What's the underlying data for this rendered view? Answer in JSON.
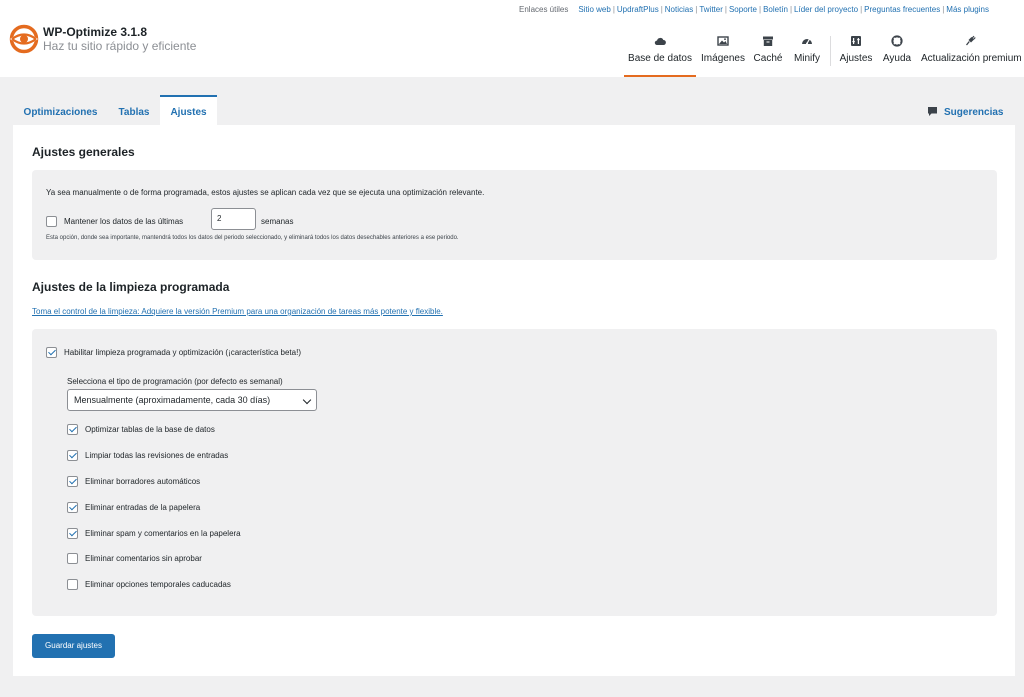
{
  "header": {
    "title": "WP-Optimize 3.1.8",
    "subtitle": "Haz tu sitio rápido y eficiente",
    "useful_links_label": "Enlaces útiles",
    "links": [
      "Sitio web",
      "UpdraftPlus",
      "Noticias",
      "Twitter",
      "Soporte",
      "Boletín",
      "Líder del proyecto",
      "Preguntas frecuentes",
      "Más plugins"
    ]
  },
  "nav": [
    {
      "label": "Base de datos",
      "icon": "cloud-icon"
    },
    {
      "label": "Imágenes",
      "icon": "images-icon"
    },
    {
      "label": "Caché",
      "icon": "archive-icon"
    },
    {
      "label": "Minify",
      "icon": "dashboard-icon"
    },
    {
      "label": "Ajustes",
      "icon": "settings-icon"
    },
    {
      "label": "Ayuda",
      "icon": "lifebuoy-icon"
    },
    {
      "label": "Actualización premium",
      "icon": "plug-icon"
    }
  ],
  "tabs": [
    "Optimizaciones",
    "Tablas",
    "Ajustes"
  ],
  "active_tab": "Ajustes",
  "feedback_label": "Sugerencias",
  "general": {
    "heading": "Ajustes generales",
    "description": "Ya sea manualmente o de forma programada, estos ajustes se aplican cada vez que se ejecuta una optimización relevante.",
    "keep_prefix": "Mantener los datos de las últimas",
    "keep_value": "2",
    "keep_suffix": "semanas",
    "keep_checked": false,
    "note": "Esta opción, donde sea importante, mantendrá todos los datos del periodo seleccionado, y eliminará todos los datos desechables anteriores a ese periodo."
  },
  "scheduled": {
    "heading": "Ajustes de la limpieza programada",
    "premium_link": "Toma el control de la limpieza: Adquiere la versión Premium para una organización de tareas más potente y flexible.",
    "enable_label": "Habilitar limpieza programada y optimización (¡característica beta!)",
    "enable_checked": true,
    "schedule_label": "Selecciona el tipo de programación (por defecto es semanal)",
    "schedule_value": "Mensualmente (aproximadamente, cada 30 días)",
    "options": [
      {
        "label": "Optimizar tablas de la base de datos",
        "checked": true
      },
      {
        "label": "Limpiar todas las revisiones de entradas",
        "checked": true
      },
      {
        "label": "Eliminar borradores automáticos",
        "checked": true
      },
      {
        "label": "Eliminar entradas de la papelera",
        "checked": true
      },
      {
        "label": "Eliminar spam y comentarios en la papelera",
        "checked": true
      },
      {
        "label": "Eliminar comentarios sin aprobar",
        "checked": false
      },
      {
        "label": "Eliminar opciones temporales caducadas",
        "checked": false
      }
    ]
  },
  "save_label": "Guardar ajustes",
  "colors": {
    "accent": "#2271b1",
    "brand": "#e46b1f"
  }
}
